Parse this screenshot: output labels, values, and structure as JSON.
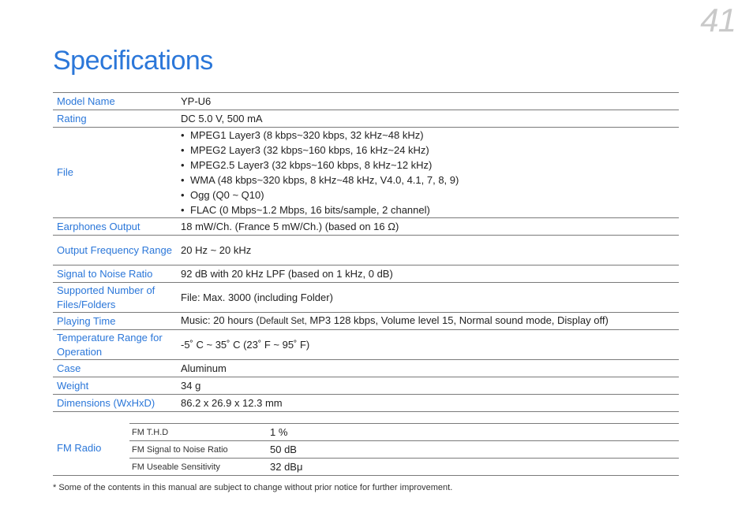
{
  "page": {
    "number": "41",
    "title": "Specifications"
  },
  "specs": [
    {
      "label": "Model Name",
      "value": "YP-U6"
    },
    {
      "label": "Rating",
      "value": "DC 5.0 V, 500 mA"
    },
    {
      "label": "File",
      "bullets": [
        "MPEG1 Layer3 (8 kbps~320 kbps, 32 kHz~48 kHz)",
        "MPEG2 Layer3 (32 kbps~160 kbps, 16 kHz~24 kHz)",
        "MPEG2.5 Layer3 (32 kbps~160 kbps, 8 kHz~12 kHz)",
        "WMA (48 kbps~320 kbps, 8 kHz~48 kHz, V4.0, 4.1, 7, 8, 9)",
        "Ogg (Q0 ~ Q10)",
        "FLAC (0 Mbps~1.2 Mbps, 16 bits/sample, 2 channel)"
      ]
    },
    {
      "label": "Earphones Output",
      "value": "18 mW/Ch. (France 5 mW/Ch.) (based on 16 Ω)"
    },
    {
      "label": "Output Frequency Range",
      "value": "20 Hz ~ 20 kHz"
    },
    {
      "label": "Signal to Noise Ratio",
      "value": "92 dB with 20 kHz LPF (based on 1 kHz, 0 dB)"
    },
    {
      "label": "Supported Number of Files/Folders",
      "value": "File: Max. 3000 (including Folder)"
    },
    {
      "label": "Playing Time",
      "value_prefix": "Music: 20 hours (",
      "value_small": "Default Set,",
      "value_suffix": " MP3 128 kbps, Volume level 15, Normal sound mode, Display off)"
    },
    {
      "label": "Temperature Range for Operation",
      "value": "-5˚ C ~ 35˚ C (23˚ F ~ 95˚ F)"
    },
    {
      "label": "Case",
      "value": "Aluminum"
    },
    {
      "label": "Weight",
      "value": "34 g"
    },
    {
      "label": "Dimensions (WxHxD)",
      "value": "86.2 x 26.9 x 12.3 mm"
    }
  ],
  "fm_radio": {
    "label": "FM Radio",
    "rows": [
      {
        "key": "FM T.H.D",
        "value": "1 %"
      },
      {
        "key": "FM Signal to Noise Ratio",
        "value": "50 dB"
      },
      {
        "key": "FM Useable Sensitivity",
        "value": "32 dBμ"
      }
    ]
  },
  "footnote": "* Some of the contents in this manual are subject to change without prior notice for further improvement.",
  "colors": {
    "accent": "#2b77d9",
    "page_number": "#c9c9c9",
    "rule": "#7a7a7a"
  }
}
